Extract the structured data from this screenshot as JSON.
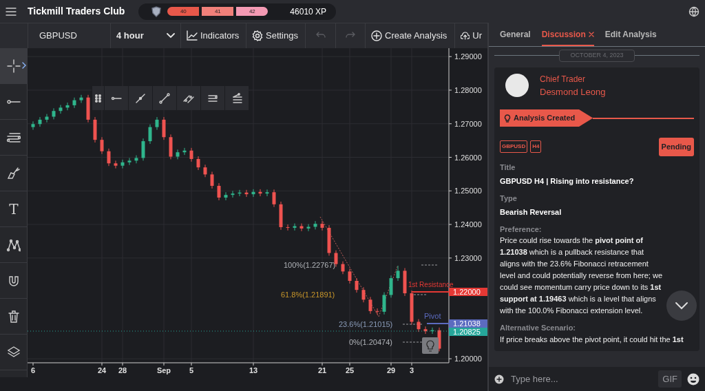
{
  "top_bar": {
    "title": "Tickmill Traders Club",
    "levels": [
      "40",
      "41",
      "42"
    ],
    "xp": "46010 XP"
  },
  "toolbar": {
    "symbol": "GBPUSD",
    "interval": "4 hour",
    "buttons": [
      {
        "kind": "indicators",
        "label": "Indicators",
        "disabled": false
      },
      {
        "kind": "settings",
        "label": "Settings",
        "disabled": false
      },
      {
        "kind": "undo",
        "disabled": true
      },
      {
        "kind": "redo",
        "disabled": true
      },
      {
        "kind": "create",
        "label": "Create Analysis",
        "disabled": false
      },
      {
        "kind": "upload",
        "label": "Ur",
        "disabled": false
      }
    ]
  },
  "tools": [
    {
      "kind": "crosshair",
      "selected": true
    },
    {
      "kind": "line",
      "selected": false
    },
    {
      "kind": "lines",
      "selected": false
    },
    {
      "kind": "brush",
      "selected": false
    },
    {
      "kind": "text",
      "label": "T",
      "selected": false
    },
    {
      "kind": "pattern",
      "selected": false
    },
    {
      "kind": "magnet",
      "selected": false
    },
    {
      "kind": "trash",
      "selected": false
    },
    {
      "kind": "layers",
      "selected": false
    }
  ],
  "chart": {
    "chart_data": {
      "type": "candlestick",
      "categories": [
        "6",
        null,
        null,
        null,
        null,
        null,
        null,
        null,
        null,
        null,
        "24",
        null,
        null,
        "28",
        null,
        null,
        null,
        null,
        null,
        "Sep",
        null,
        null,
        null,
        "5",
        null,
        null,
        null,
        null,
        null,
        null,
        null,
        null,
        "13",
        null,
        null,
        null,
        null,
        null,
        null,
        null,
        null,
        null,
        "21",
        null,
        null,
        null,
        "25",
        null,
        null,
        null,
        null,
        null,
        "29",
        null,
        null,
        "3",
        null,
        null,
        null,
        null
      ],
      "ohlc": [
        [
          1.269,
          1.2707,
          1.2682,
          1.2699
        ],
        [
          1.2699,
          1.272,
          1.2691,
          1.2712
        ],
        [
          1.2712,
          1.2729,
          1.2704,
          1.2721
        ],
        [
          1.2721,
          1.2746,
          1.2713,
          1.2738
        ],
        [
          1.2738,
          1.2756,
          1.273,
          1.2748
        ],
        [
          1.2748,
          1.2763,
          1.274,
          1.2755
        ],
        [
          1.2755,
          1.2778,
          1.2747,
          1.277
        ],
        [
          1.277,
          1.2786,
          1.2762,
          1.2778
        ],
        [
          1.2778,
          1.2786,
          1.2704,
          1.2712
        ],
        [
          1.2712,
          1.272,
          1.2644,
          1.2652
        ],
        [
          1.2652,
          1.266,
          1.261,
          1.2618
        ],
        [
          1.2618,
          1.2626,
          1.2574,
          1.2582
        ],
        [
          1.2582,
          1.259,
          1.2567,
          1.2575
        ],
        [
          1.2575,
          1.2593,
          1.2567,
          1.2585
        ],
        [
          1.2585,
          1.2598,
          1.2577,
          1.259
        ],
        [
          1.259,
          1.2606,
          1.2582,
          1.2598
        ],
        [
          1.2598,
          1.2656,
          1.259,
          1.2648
        ],
        [
          1.2648,
          1.2698,
          1.264,
          1.269
        ],
        [
          1.269,
          1.272,
          1.2682,
          1.2712
        ],
        [
          1.2712,
          1.272,
          1.2652,
          1.266
        ],
        [
          1.266,
          1.2668,
          1.2594,
          1.2602
        ],
        [
          1.2602,
          1.2623,
          1.2594,
          1.2615
        ],
        [
          1.2615,
          1.2628,
          1.2607,
          1.262
        ],
        [
          1.262,
          1.2628,
          1.2587,
          1.2595
        ],
        [
          1.2595,
          1.2603,
          1.2562,
          1.257
        ],
        [
          1.257,
          1.2578,
          1.2541,
          1.2549
        ],
        [
          1.2549,
          1.2557,
          1.2507,
          1.2515
        ],
        [
          1.2515,
          1.2523,
          1.2472,
          1.248
        ],
        [
          1.248,
          1.2496,
          1.2472,
          1.2488
        ],
        [
          1.2488,
          1.25,
          1.248,
          1.2492
        ],
        [
          1.2492,
          1.2503,
          1.2484,
          1.2495
        ],
        [
          1.2495,
          1.2503,
          1.2482,
          1.249
        ],
        [
          1.249,
          1.2505,
          1.2482,
          1.2497
        ],
        [
          1.2497,
          1.2505,
          1.2484,
          1.2492
        ],
        [
          1.2492,
          1.2504,
          1.2484,
          1.2496
        ],
        [
          1.2496,
          1.2504,
          1.2452,
          1.246
        ],
        [
          1.246,
          1.2468,
          1.2384,
          1.2392
        ],
        [
          1.2392,
          1.24,
          1.2382,
          1.239
        ],
        [
          1.239,
          1.2403,
          1.2382,
          1.2395
        ],
        [
          1.2395,
          1.2403,
          1.238,
          1.2388
        ],
        [
          1.2388,
          1.2401,
          1.238,
          1.2393
        ],
        [
          1.2393,
          1.241,
          1.2385,
          1.2402
        ],
        [
          1.2402,
          1.241,
          1.2382,
          1.239
        ],
        [
          1.239,
          1.2398,
          1.2307,
          1.2315
        ],
        [
          1.2315,
          1.2323,
          1.2274,
          1.2282
        ],
        [
          1.2282,
          1.229,
          1.2252,
          1.226
        ],
        [
          1.226,
          1.2268,
          1.2224,
          1.2232
        ],
        [
          1.2232,
          1.224,
          1.2197,
          1.2205
        ],
        [
          1.2205,
          1.2213,
          1.2168,
          1.2176
        ],
        [
          1.2176,
          1.2184,
          1.2134,
          1.2142
        ],
        [
          1.2142,
          1.215,
          1.2132,
          1.214
        ],
        [
          1.214,
          1.2198,
          1.2132,
          1.219
        ],
        [
          1.219,
          1.2248,
          1.2182,
          1.224
        ],
        [
          1.224,
          1.2277,
          1.2232,
          1.2262
        ],
        [
          1.2262,
          1.227,
          1.2187,
          1.2195
        ],
        [
          1.2195,
          1.2203,
          1.2102,
          1.211
        ],
        [
          1.211,
          1.2118,
          1.208,
          1.2088
        ],
        [
          1.2088,
          1.2096,
          1.2074,
          1.2082
        ],
        [
          1.2082,
          1.2093,
          1.2074,
          1.2085
        ],
        [
          1.2085,
          1.2093,
          1.2022,
          1.203
        ]
      ],
      "ylim": [
        1.1988,
        1.2925
      ],
      "grid": true,
      "yticks": [
        {
          "value": 1.29,
          "label": "1.29000"
        },
        {
          "value": 1.28,
          "label": "1.28000"
        },
        {
          "value": 1.27,
          "label": "1.27000"
        },
        {
          "value": 1.26,
          "label": "1.26000"
        },
        {
          "value": 1.25,
          "label": "1.25000"
        },
        {
          "value": 1.24,
          "label": "1.24000"
        },
        {
          "value": 1.23,
          "label": "1.23000"
        },
        {
          "value": 1.2,
          "label": "1.20000"
        }
      ]
    },
    "price_tags": [
      {
        "label": "1.22000",
        "color": "#e53935"
      },
      {
        "label": "1.21038",
        "color": "#5c6bc0"
      },
      {
        "label": "1.20825",
        "color": "#26a69a"
      }
    ],
    "fib_levels": [
      {
        "label": "100%(1.22767)",
        "color": "#b0b3b8"
      },
      {
        "label": "61.8%(1.21891)",
        "color": "#c8962a"
      },
      {
        "label": "23.6%(1.21015)",
        "color": "#8a9bb8"
      },
      {
        "label": "0%(1.20474)",
        "color": "#b0b3b8"
      }
    ],
    "line_labels": [
      {
        "label": "1st Resistance",
        "color": "#e53935"
      },
      {
        "label": "Pivot",
        "color": "#5c6bc0"
      }
    ]
  },
  "panel": {
    "tabs": [
      {
        "label": "General",
        "selected": false,
        "closable": false
      },
      {
        "label": "Discussion",
        "selected": true,
        "closable": true
      },
      {
        "label": "Edit Analysis",
        "selected": false,
        "closable": false
      }
    ],
    "date": "OCTOBER 4, 2023",
    "author": {
      "role": "Chief Trader",
      "name": "Desmond Leong"
    },
    "event": "Analysis Created",
    "tags": [
      "GBPUSD",
      "H4"
    ],
    "status": "Pending",
    "fields": [
      {
        "kind": "heading",
        "label": "Title",
        "value": "GBPUSD H4 | Rising into resistance?"
      },
      {
        "kind": "heading",
        "label": "Type",
        "value": "Bearish Reversal"
      },
      {
        "kind": "paragraph",
        "label": "Preference:",
        "value": "Price could rise towards the **pivot point of 1.21038** which is a pullback resistance that aligns with the 23.6% Fibonacci retracement level and could potentially reverse from here; we could see momentum carry price down to its **1st support at 1.19463** which is a level that aligns with the 100.0% Fibonacci extension level."
      },
      {
        "kind": "paragraph",
        "label": "Alternative Scenario:",
        "value": "If price breaks above the pivot point, it could hit the **1st**"
      }
    ],
    "composer": {
      "placeholder": "Type here...",
      "gif": "GIF"
    }
  }
}
